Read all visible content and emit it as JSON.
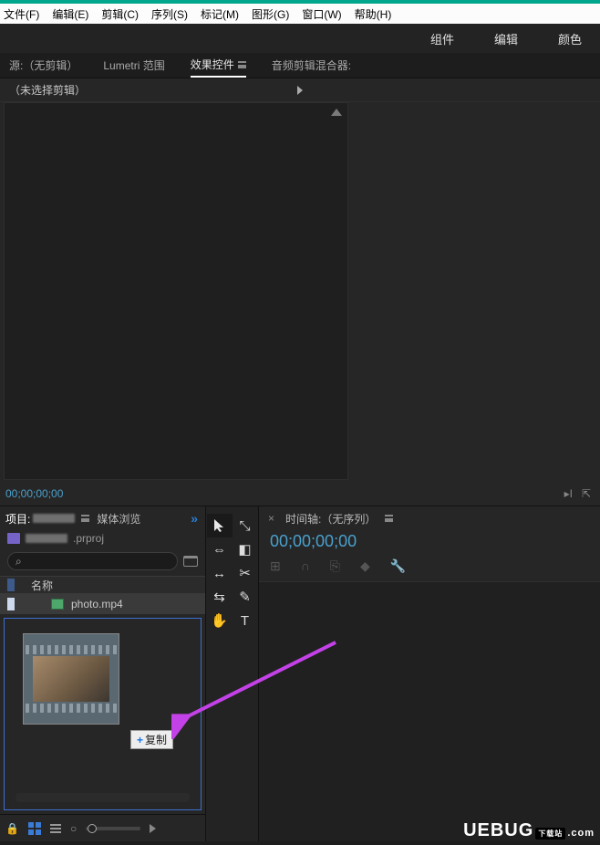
{
  "menu": {
    "file": "文件(F)",
    "edit": "编辑(E)",
    "clip": "剪辑(C)",
    "sequence": "序列(S)",
    "marker": "标记(M)",
    "graphics": "图形(G)",
    "window": "窗口(W)",
    "help": "帮助(H)"
  },
  "workspace": {
    "assembly": "组件",
    "editing": "编辑",
    "color": "颜色"
  },
  "source_tabs": {
    "source": "源:（无剪辑）",
    "lumetri": "Lumetri 范围",
    "effects": "效果控件",
    "audio": "音频剪辑混合器:"
  },
  "source_panel": {
    "placeholder": "（未选择剪辑）",
    "timecode": "00;00;00;00"
  },
  "project": {
    "tab_project": "项目:",
    "tab_media": "媒体浏览",
    "file_suffix": ".prproj",
    "search_placeholder": "",
    "search_icon": "⌕",
    "header_name": "名称",
    "item_name": "photo.mp4",
    "copy_btn": "复制"
  },
  "timeline": {
    "tab": "时间轴:（无序列）",
    "timecode": "00;00;00;00"
  },
  "tools": {
    "select": "▲",
    "track": "⇆",
    "ripple": "⇔",
    "razor": "✂",
    "rate": "↔",
    "pen": "✎",
    "hand": "✋",
    "type": "T",
    "t2": "⤡",
    "t3": "◧"
  },
  "watermark": {
    "brand": "UEBUG",
    "badge": "下载站",
    "tld": ".com"
  }
}
